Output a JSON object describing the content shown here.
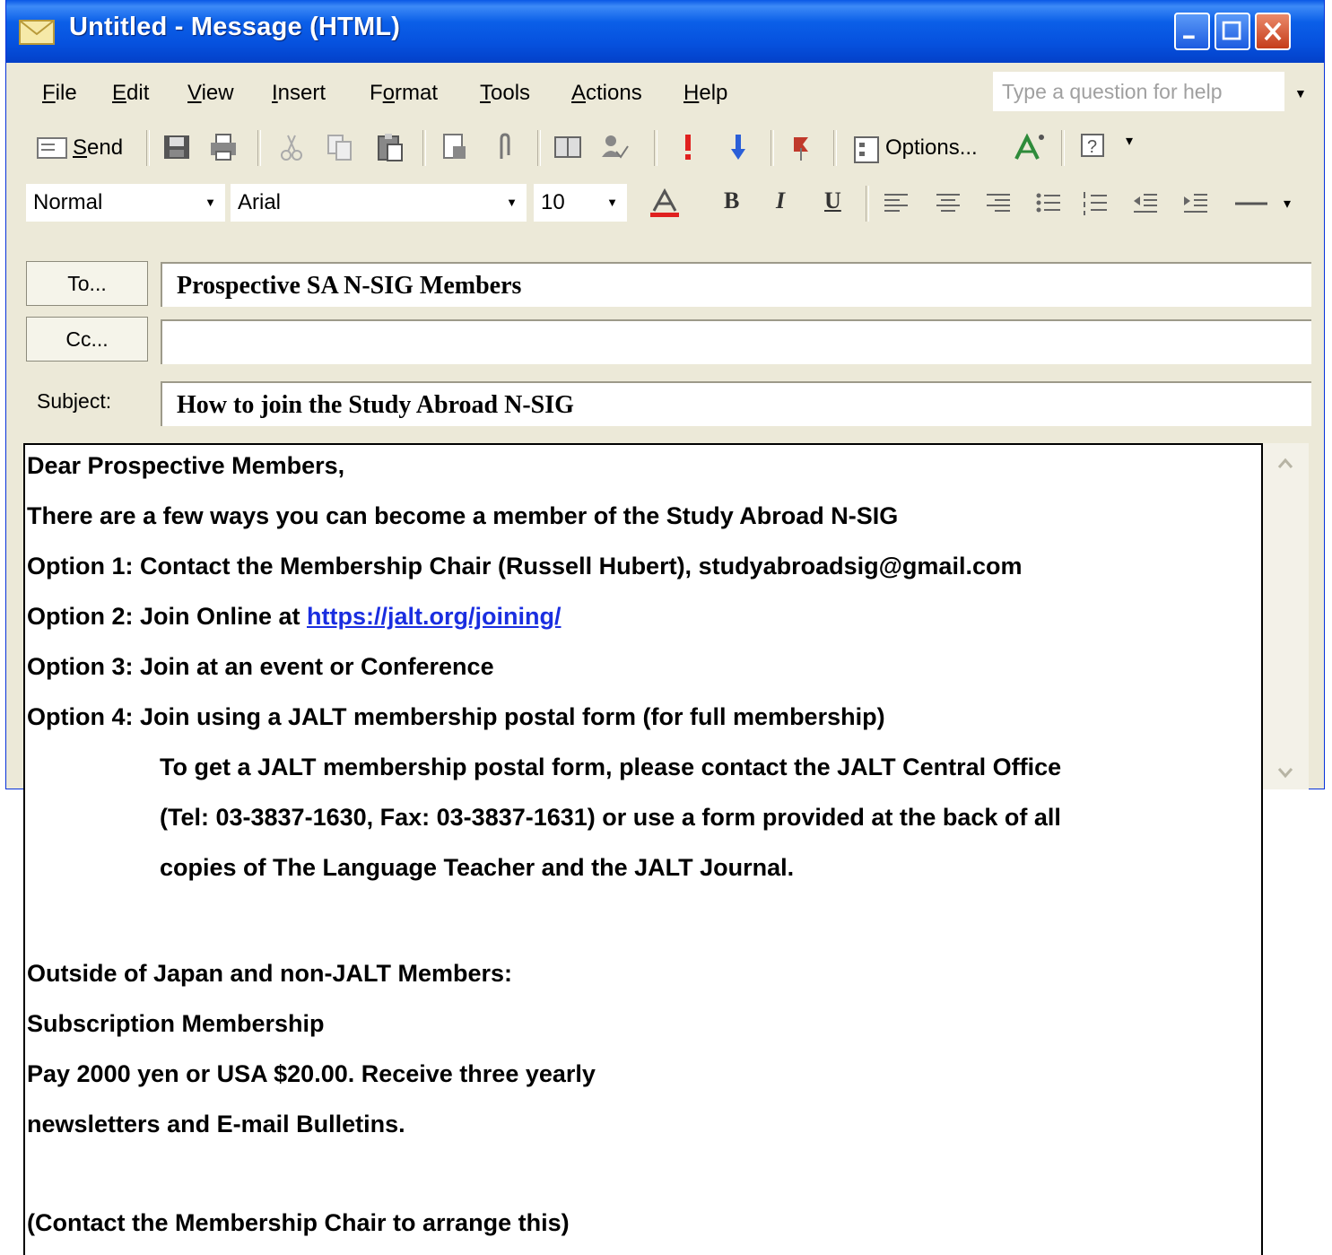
{
  "window": {
    "title": "Untitled - Message (HTML)"
  },
  "menubar": {
    "items": [
      {
        "label": "File",
        "accel": "F",
        "rest": "ile"
      },
      {
        "label": "Edit",
        "accel": "E",
        "rest": "dit"
      },
      {
        "label": "View",
        "accel": "V",
        "rest": "iew"
      },
      {
        "label": "Insert",
        "accel": "I",
        "rest": "nsert"
      },
      {
        "label": "Format",
        "pre": "F",
        "accel": "o",
        "rest": "rmat"
      },
      {
        "label": "Tools",
        "accel": "T",
        "rest": "ools"
      },
      {
        "label": "Actions",
        "accel": "A",
        "rest": "ctions"
      },
      {
        "label": "Help",
        "accel": "H",
        "rest": "elp"
      }
    ],
    "help_placeholder": "Type a question for help"
  },
  "toolbar": {
    "send_label": "Send",
    "options_label": "Options...",
    "style_value": "Normal",
    "font_value": "Arial",
    "size_value": "10",
    "bold": "B",
    "italic": "I",
    "underline": "U"
  },
  "header": {
    "to_button": "To...",
    "cc_button": "Cc...",
    "subject_label": "Subject:",
    "to_value": "Prospective SA N-SIG Members",
    "cc_value": "",
    "subject_value": "How to join the Study Abroad N-SIG"
  },
  "body": {
    "greeting": "Dear Prospective Members,",
    "intro": "There are a few ways you can become a member of the Study Abroad N-SIG",
    "option1": "Option 1: Contact the Membership Chair (Russell Hubert), studyabroadsig@gmail.com",
    "option2_prefix": "Option 2: Join Online at ",
    "option2_link": "https://jalt.org/joining/",
    "option3": "Option 3: Join at an event or Conference",
    "option4": "Option 4: Join using a JALT membership postal form (for full membership)",
    "option4_detail_1": "To get a JALT membership postal form, please contact the JALT Central Office",
    "option4_detail_2": "(Tel: 03-3837-1630, Fax: 03-3837-1631) or use a form provided at the back of all",
    "option4_detail_3": "copies of The Language Teacher and the JALT Journal.",
    "outside_heading": "Outside of Japan and non-JALT Members:",
    "subscription": "Subscription Membership",
    "pay_line_1": "Pay 2000 yen or USA $20.00. Receive three yearly",
    "pay_line_2": "newsletters and E-mail Bulletins.",
    "contact_note": "(Contact the Membership Chair to arrange this)"
  },
  "colors": {
    "titlebar": "#0651de",
    "chrome": "#ece9d8",
    "link": "#1a2ee0"
  }
}
